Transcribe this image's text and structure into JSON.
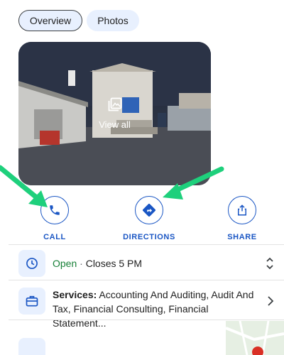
{
  "tabs": [
    {
      "label": "Overview"
    },
    {
      "label": "Photos"
    }
  ],
  "photo": {
    "view_all_label": "View all"
  },
  "actions": [
    {
      "label": "CALL",
      "icon": "phone-icon"
    },
    {
      "label": "DIRECTIONS",
      "icon": "directions-icon"
    },
    {
      "label": "SHARE",
      "icon": "share-icon"
    }
  ],
  "hours": {
    "status": "Open",
    "separator": "·",
    "closes": "Closes 5 PM"
  },
  "services": {
    "label": "Services:",
    "value": "Accounting And Auditing, Audit And Tax, Financial Consulting, Financial Statement..."
  },
  "colors": {
    "accent": "#1a56c4",
    "open_green": "#188038",
    "annotation_arrow": "#1ed07c",
    "chip_bg": "#e8f0fe"
  }
}
